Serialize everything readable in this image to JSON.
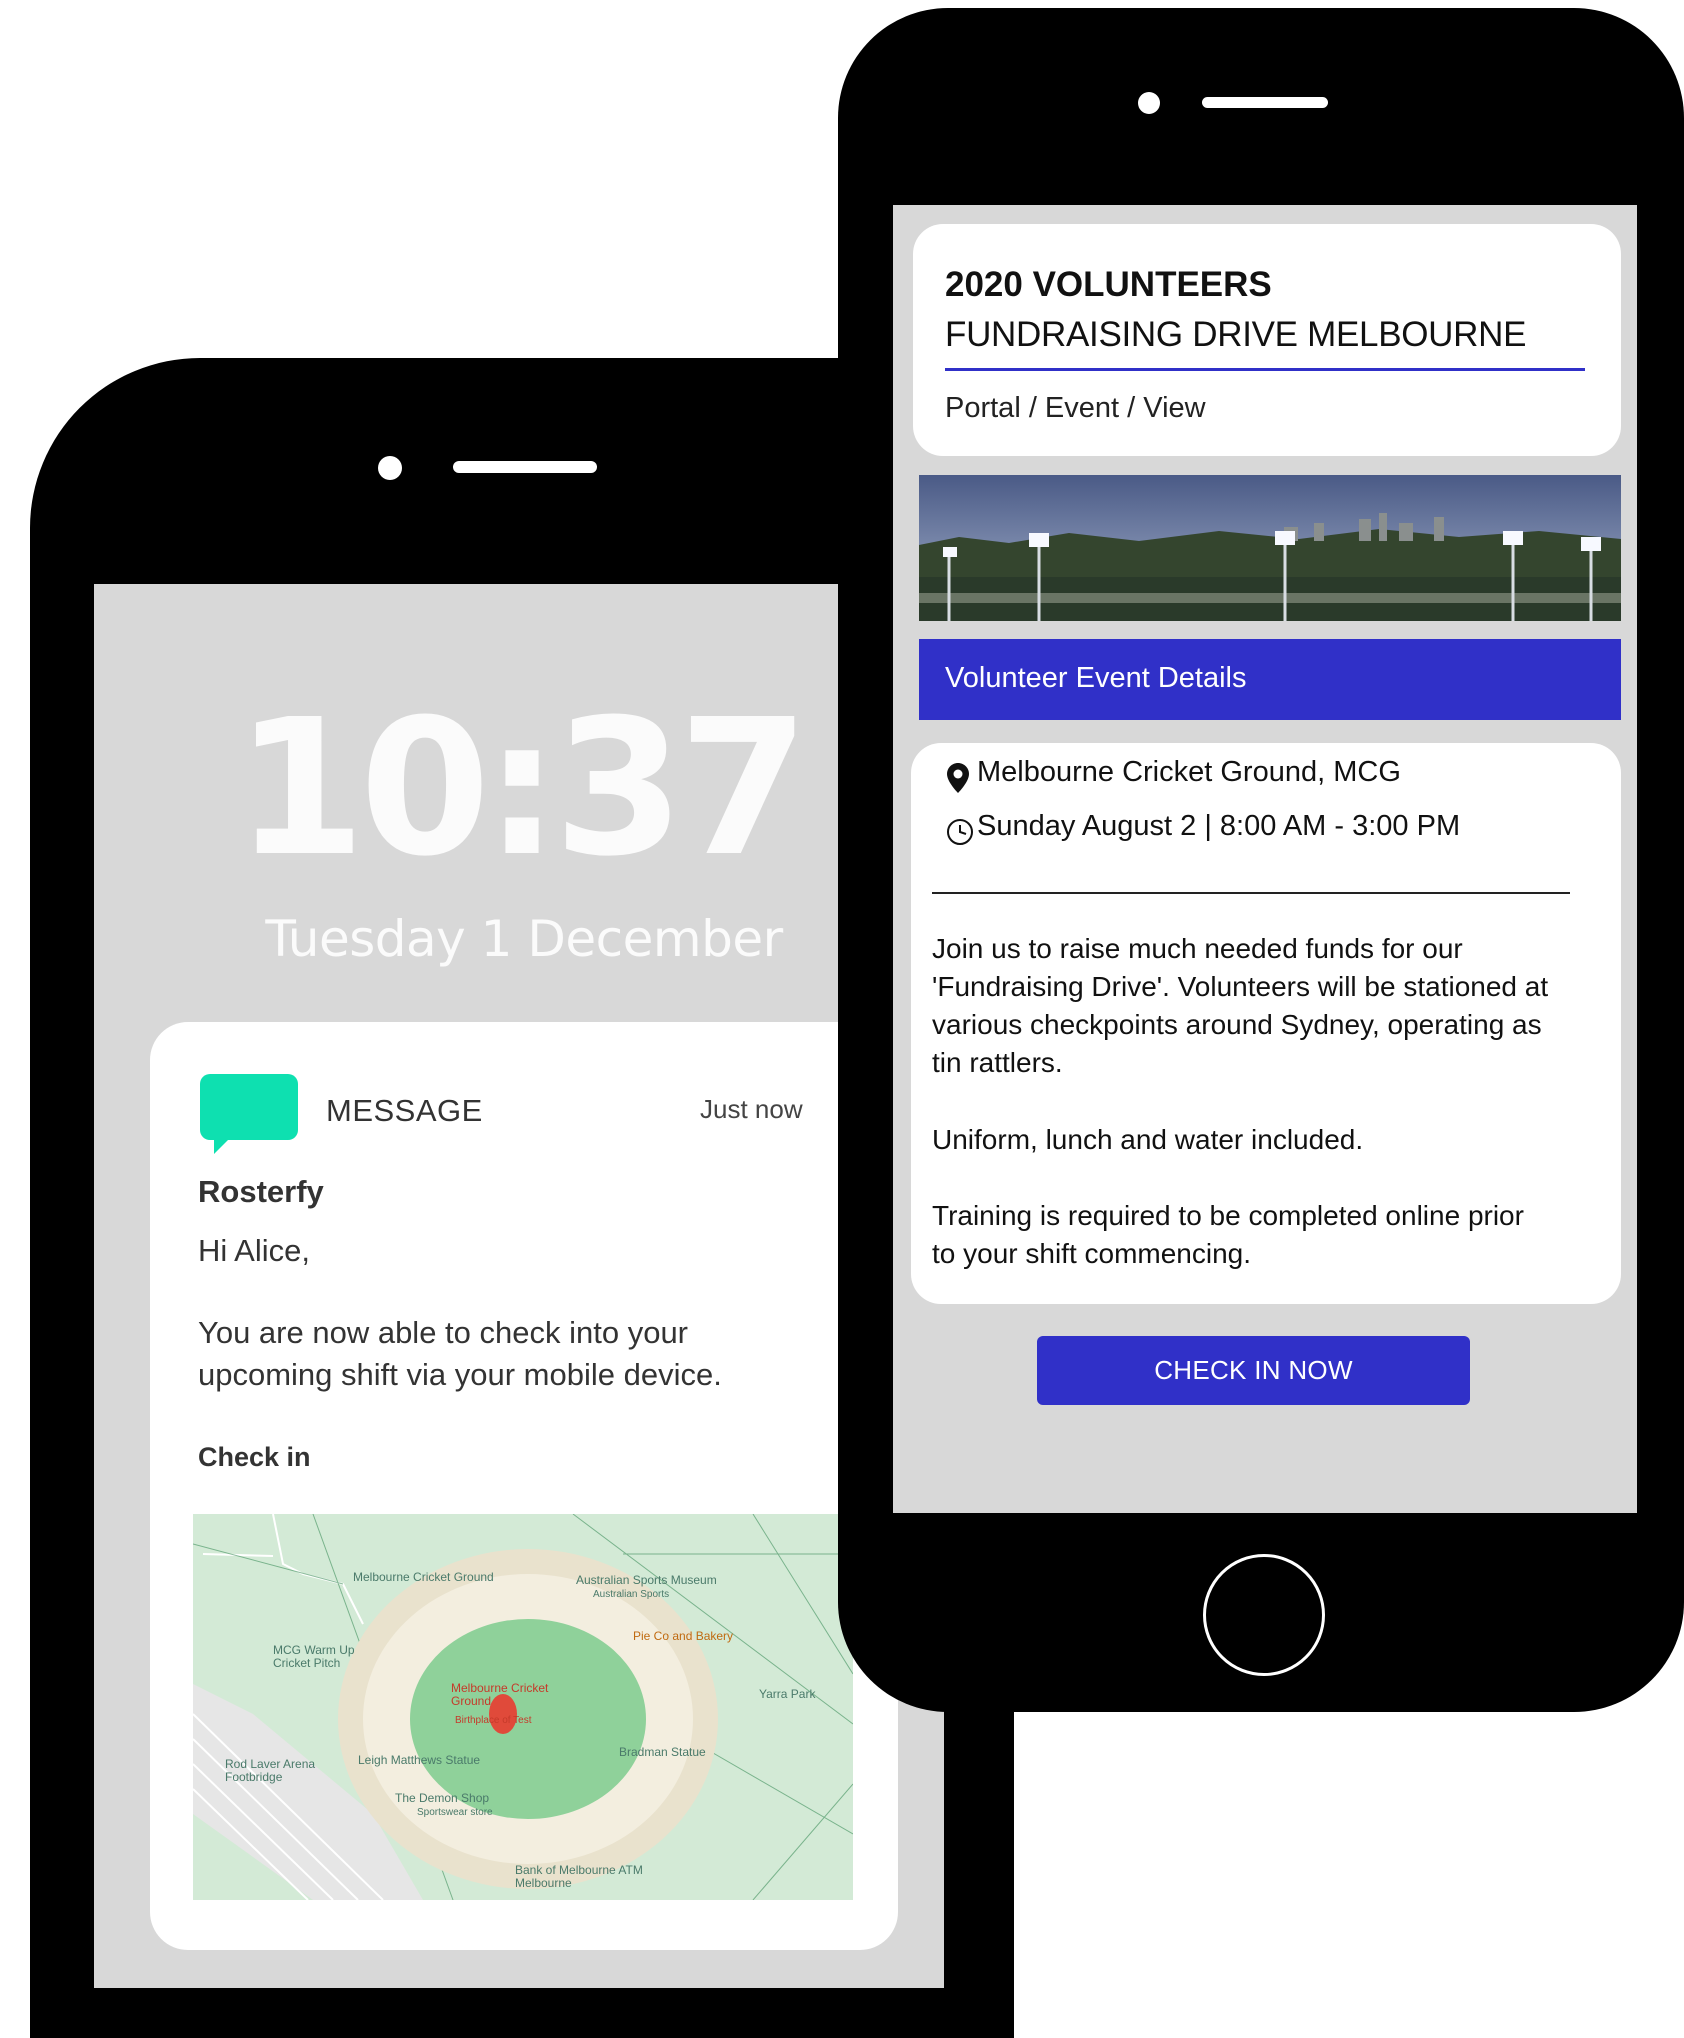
{
  "lock_screen": {
    "time": "10:37",
    "date": "Tuesday 1 December"
  },
  "notification": {
    "app_label": "MESSAGE",
    "timestamp": "Just now",
    "sender": "Rosterfy",
    "greeting": "Hi Alice,",
    "body": "You are now able to check into your upcoming shift via your mobile device.",
    "action_label": "Check in",
    "icon_color": "#0ee0b0"
  },
  "map": {
    "labels": [
      "Melbourne Cricket Ground",
      "Australian Sports Museum",
      "Australian Sports",
      "Pie Co and Bakery",
      "MCG Warm Up Cricket Pitch",
      "Melbourne Cricket Ground",
      "Birthplace of Test",
      "Yarra Park",
      "Rod Laver Arena Footbridge",
      "Leigh Matthews Statue",
      "Bradman Statue",
      "The Demon Shop",
      "Sportswear store",
      "Bank of Melbourne ATM Melbourne"
    ]
  },
  "event": {
    "title": "2020 VOLUNTEERS",
    "subtitle": "FUNDRAISING DRIVE MELBOURNE",
    "breadcrumb": "Portal / Event / View",
    "details_heading": "Volunteer Event Details",
    "location": "Melbourne Cricket Ground, MCG",
    "datetime": "Sunday August 2 | 8:00 AM - 3:00 PM",
    "description": [
      "Join us to raise much needed funds for our 'Fundraising Drive'. Volunteers will be stationed at various checkpoints around Sydney, operating as tin rattlers.",
      "Uniform, lunch and water included.",
      "Training is required to be completed online prior to your shift commencing."
    ],
    "checkin_button": "CHECK IN NOW",
    "accent_color": "#3030c8"
  }
}
